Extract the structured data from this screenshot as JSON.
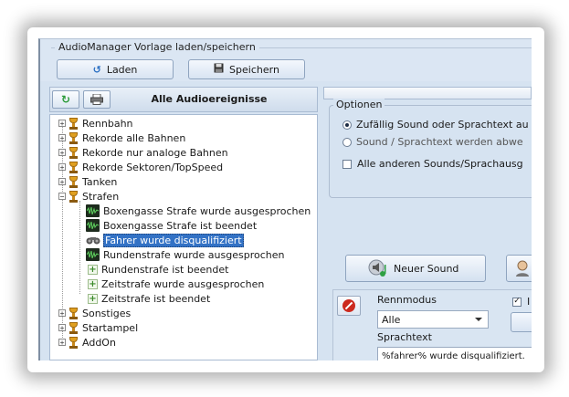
{
  "window": {
    "group_title": "AudioManager Vorlage laden/speichern",
    "load_label": "Laden",
    "save_label": "Speichern"
  },
  "left_panel": {
    "header_title": "Alle Audioereignisse"
  },
  "tree": {
    "items": [
      {
        "label": "Rennbahn"
      },
      {
        "label": "Rekorde alle Bahnen"
      },
      {
        "label": "Rekorde nur analoge Bahnen"
      },
      {
        "label": "Rekorde Sektoren/TopSpeed"
      },
      {
        "label": "Tanken"
      },
      {
        "label": "Strafen"
      },
      {
        "label": "Boxengasse Strafe wurde ausgesprochen"
      },
      {
        "label": "Boxengasse Strafe ist beendet"
      },
      {
        "label": "Fahrer wurde disqualifiziert"
      },
      {
        "label": "Rundenstrafe wurde ausgesprochen"
      },
      {
        "label": "Rundenstrafe ist beendet"
      },
      {
        "label": "Zeitstrafe wurde ausgesprochen"
      },
      {
        "label": "Zeitstrafe ist beendet"
      },
      {
        "label": "Sonstiges"
      },
      {
        "label": "Startampel"
      },
      {
        "label": "AddOn"
      }
    ],
    "selected_index": 8
  },
  "options": {
    "legend": "Optionen",
    "radio_random": "Zufällig Sound oder Sprachtext au",
    "radio_alternate": "Sound / Sprachtext werden abwe",
    "checkbox_others": "Alle anderen Sounds/Sprachausg"
  },
  "sound_buttons": {
    "new_sound": "Neuer Sound"
  },
  "entry": {
    "mode_label": "Rennmodus",
    "mode_value": "Alle",
    "speech_label": "Sprachtext",
    "speech_value": "%fahrer% wurde disqualifiziert.",
    "checkbox_partial": "I"
  },
  "colors": {
    "window_bg": "#d6e3f1",
    "selection": "#3372c5",
    "trophy": "#e0a020"
  }
}
